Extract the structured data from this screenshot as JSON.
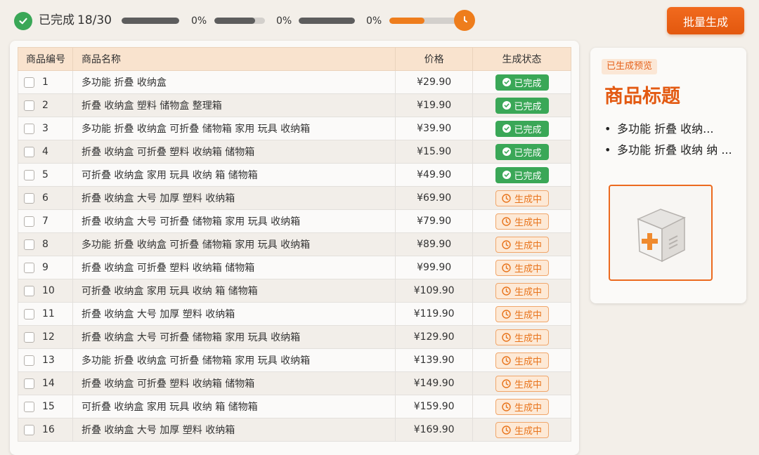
{
  "header": {
    "done_label": "已完成",
    "done_count": "18/30",
    "progress": [
      {
        "label": "0%",
        "fill": 1.0,
        "color": "#5d5d5d"
      },
      {
        "label": "0%",
        "fill": 0.8,
        "color": "#5d5d5d"
      },
      {
        "label": "0%",
        "fill": 1.0,
        "color": "#5d5d5d"
      },
      {
        "label": "",
        "fill": 0.5,
        "color": "#ee7d1c"
      }
    ],
    "batch_button": "批量生成",
    "accent_color": "#e3580e"
  },
  "table": {
    "columns": [
      "商品编号",
      "商品名称",
      "价格",
      "生成状态"
    ],
    "rows": [
      {
        "id": "1",
        "name": "多功能 折叠 收纳盒",
        "price": "¥29.90",
        "status": "已完成",
        "state": "done"
      },
      {
        "id": "2",
        "name": "折叠 收纳盒 塑料 储物盒 整理箱",
        "price": "¥19.90",
        "status": "已完成",
        "state": "done"
      },
      {
        "id": "3",
        "name": "多功能 折叠 收纳盒 可折叠 储物箱 家用 玩具 收纳箱",
        "price": "¥39.90",
        "status": "已完成",
        "state": "done"
      },
      {
        "id": "4",
        "name": "折叠 收纳盒 可折叠 塑料 收纳箱 储物箱",
        "price": "¥15.90",
        "status": "已完成",
        "state": "done"
      },
      {
        "id": "5",
        "name": "可折叠 收纳盒 家用 玩具 收纳 箱 储物箱",
        "price": "¥49.90",
        "status": "已完成",
        "state": "done"
      },
      {
        "id": "6",
        "name": "折叠 收纳盒 大号 加厚 塑料 收纳箱",
        "price": "¥69.90",
        "status": "生成中",
        "state": "generating"
      },
      {
        "id": "7",
        "name": "折叠 收纳盒 大号 可折叠 储物箱 家用 玩具 收纳箱",
        "price": "¥79.90",
        "status": "生成中",
        "state": "generating"
      },
      {
        "id": "8",
        "name": "多功能 折叠 收纳盒 可折叠 储物箱 家用 玩具 收纳箱",
        "price": "¥89.90",
        "status": "生成中",
        "state": "generating"
      },
      {
        "id": "9",
        "name": "折叠 收纳盒 可折叠 塑料 收纳箱 储物箱",
        "price": "¥99.90",
        "status": "生成中",
        "state": "generating"
      },
      {
        "id": "10",
        "name": "可折叠 收纳盒 家用 玩具 收纳 箱 储物箱",
        "price": "¥109.90",
        "status": "生成中",
        "state": "generating"
      },
      {
        "id": "11",
        "name": "折叠 收纳盒 大号 加厚 塑料 收纳箱",
        "price": "¥119.90",
        "status": "生成中",
        "state": "generating"
      },
      {
        "id": "12",
        "name": "折叠 收纳盒 大号 可折叠 储物箱 家用 玩具 收纳箱",
        "price": "¥129.90",
        "status": "生成中",
        "state": "generating"
      },
      {
        "id": "13",
        "name": "多功能 折叠 收纳盒 可折叠 储物箱 家用 玩具 收纳箱",
        "price": "¥139.90",
        "status": "生成中",
        "state": "generating"
      },
      {
        "id": "14",
        "name": "折叠 收纳盒 可折叠 塑料 收纳箱 储物箱",
        "price": "¥149.90",
        "status": "生成中",
        "state": "generating"
      },
      {
        "id": "15",
        "name": "可折叠 收纳盒 家用 玩具 收纳 箱 储物箱",
        "price": "¥159.90",
        "status": "生成中",
        "state": "generating"
      },
      {
        "id": "16",
        "name": "折叠 收纳盒 大号 加厚 塑料 收纳箱",
        "price": "¥169.90",
        "status": "生成中",
        "state": "generating"
      }
    ]
  },
  "preview": {
    "tag": "已生成预览",
    "title": "商品标题",
    "bullets": [
      "多功能 折叠 收纳...",
      "多功能 折叠 收纳 纳 ..."
    ],
    "image_icon": "storage-box-icon"
  }
}
